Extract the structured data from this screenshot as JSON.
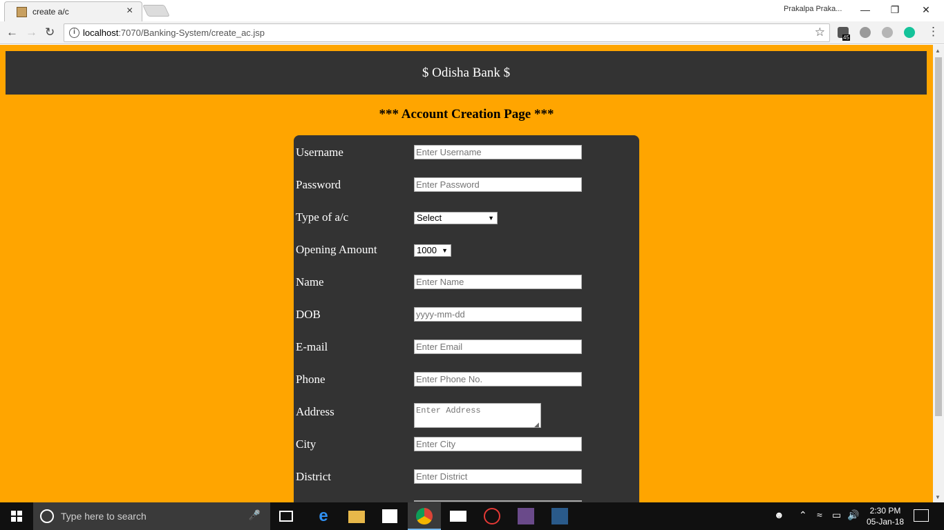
{
  "browser": {
    "tab_title": "create a/c",
    "tab_close": "×",
    "profile_name": "Prakalpa Praka...",
    "url_host": "localhost",
    "url_rest": ":7070/Banking-System/create_ac.jsp",
    "extension_badge": "45"
  },
  "page": {
    "bank_name": "$ Odisha Bank $",
    "title": "*** Account Creation Page ***"
  },
  "form": {
    "username": {
      "label": "Username",
      "placeholder": "Enter Username"
    },
    "password": {
      "label": "Password",
      "placeholder": "Enter Password"
    },
    "account_type": {
      "label": "Type of a/c",
      "selected": "Select"
    },
    "opening_amount": {
      "label": "Opening Amount",
      "selected": "1000"
    },
    "name": {
      "label": "Name",
      "placeholder": "Enter Name"
    },
    "dob": {
      "label": "DOB",
      "placeholder": "yyyy-mm-dd"
    },
    "email": {
      "label": "E-mail",
      "placeholder": "Enter Email"
    },
    "phone": {
      "label": "Phone",
      "placeholder": "Enter Phone No."
    },
    "address": {
      "label": "Address",
      "placeholder": "Enter Address"
    },
    "city": {
      "label": "City",
      "placeholder": "Enter City"
    },
    "district": {
      "label": "District",
      "placeholder": "Enter District"
    }
  },
  "taskbar": {
    "search_placeholder": "Type here to search",
    "time": "2:30 PM",
    "date": "05-Jan-18"
  },
  "colors": {
    "page_background": "#ffa500",
    "header_background": "#333333",
    "form_background": "#333333"
  }
}
